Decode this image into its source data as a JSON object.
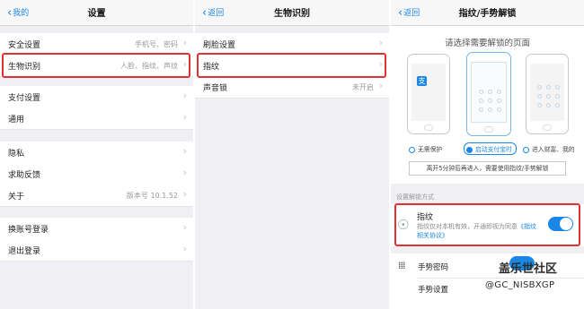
{
  "panel1": {
    "nav": {
      "back": "我的",
      "title": "设置"
    },
    "rows": [
      {
        "label": "安全设置",
        "value": "手机号、密码"
      },
      {
        "label": "生物识别",
        "value": "人脸、指纹、声纹"
      },
      {
        "label": "支付设置",
        "value": ""
      },
      {
        "label": "通用",
        "value": ""
      },
      {
        "label": "隐私",
        "value": ""
      },
      {
        "label": "求助反馈",
        "value": ""
      },
      {
        "label": "关于",
        "value": "版本号 10.1.52"
      },
      {
        "label": "换账号登录",
        "value": ""
      },
      {
        "label": "退出登录",
        "value": ""
      }
    ]
  },
  "panel2": {
    "nav": {
      "back": "返回",
      "title": "生物识别"
    },
    "rows": [
      {
        "label": "刷脸设置",
        "value": ""
      },
      {
        "label": "指纹",
        "value": ""
      },
      {
        "label": "声音锁",
        "value": "未开启"
      }
    ]
  },
  "panel3": {
    "nav": {
      "back": "返回",
      "title": "指纹/手势解锁"
    },
    "prompt": "请选择需要解锁的页面",
    "phone_app_label": "支",
    "options": [
      "无需保护",
      "启动支付宝时",
      "进入财富、我的"
    ],
    "tip": "离开5分钟后再进入，需要使用指纹/手势解锁",
    "section_label": "设置解锁方式",
    "fingerprint": {
      "title": "指纹",
      "desc": "指纹仅对本机有效，开通即视为同意",
      "link": "《指纹相关协议》",
      "enabled": true
    },
    "gesture": {
      "row1": "手势密码",
      "row2": "手势设置"
    }
  },
  "watermark": {
    "line1": "盖乐世社区",
    "line2": "@GC_NISBXGP"
  },
  "colors": {
    "accent": "#1a87e6",
    "highlight": "#e03232"
  }
}
